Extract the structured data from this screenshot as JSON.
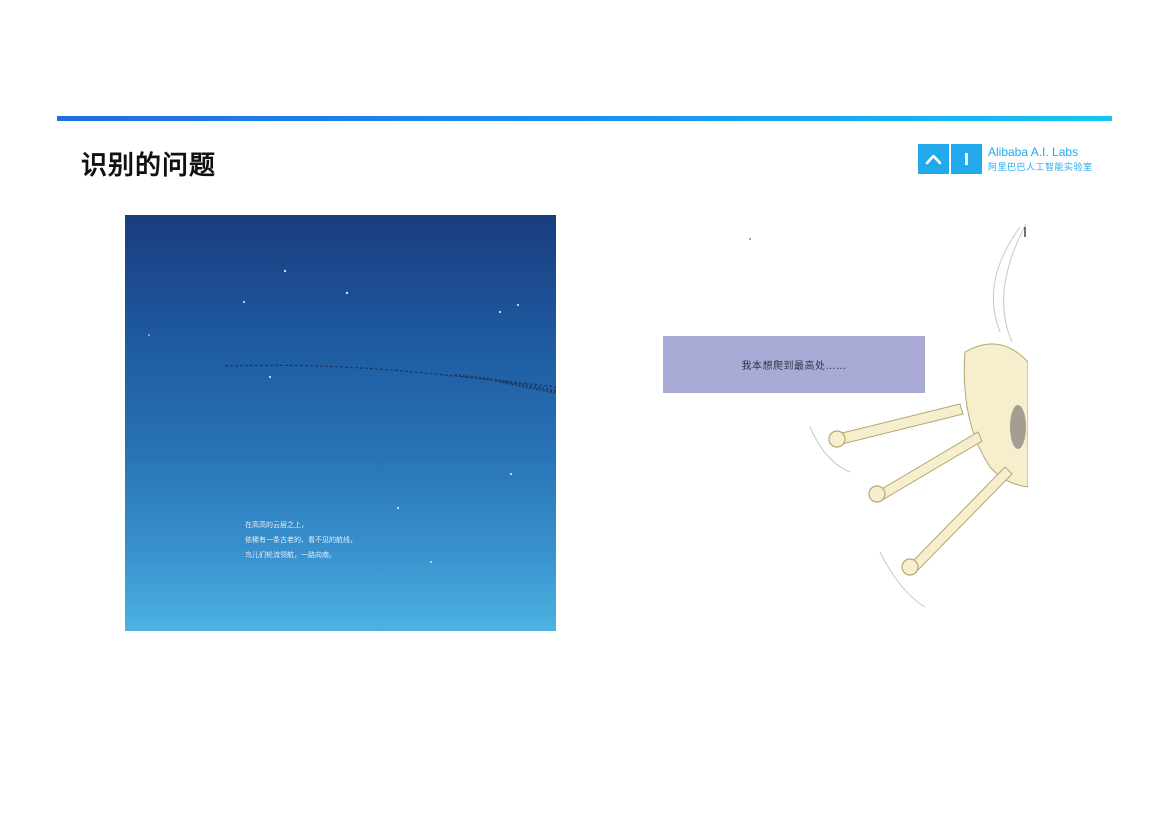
{
  "header": {
    "title": "识别的问题"
  },
  "logo": {
    "en": "Alibaba A.I. Labs",
    "cn": "阿里巴巴人工智能实验室"
  },
  "left_page": {
    "poem_lines": [
      "在高高的云层之上，",
      "依稀有一条古老的、看不见的航线，",
      "鸟儿们轮流领航，一路向南。"
    ]
  },
  "right_page": {
    "caption": "我本想爬到最高处……"
  },
  "colors": {
    "accent": "#21a9ec",
    "bar_start": "#1f6fe0",
    "bar_end": "#12c6f4",
    "caption_bg": "#a9abd6"
  }
}
